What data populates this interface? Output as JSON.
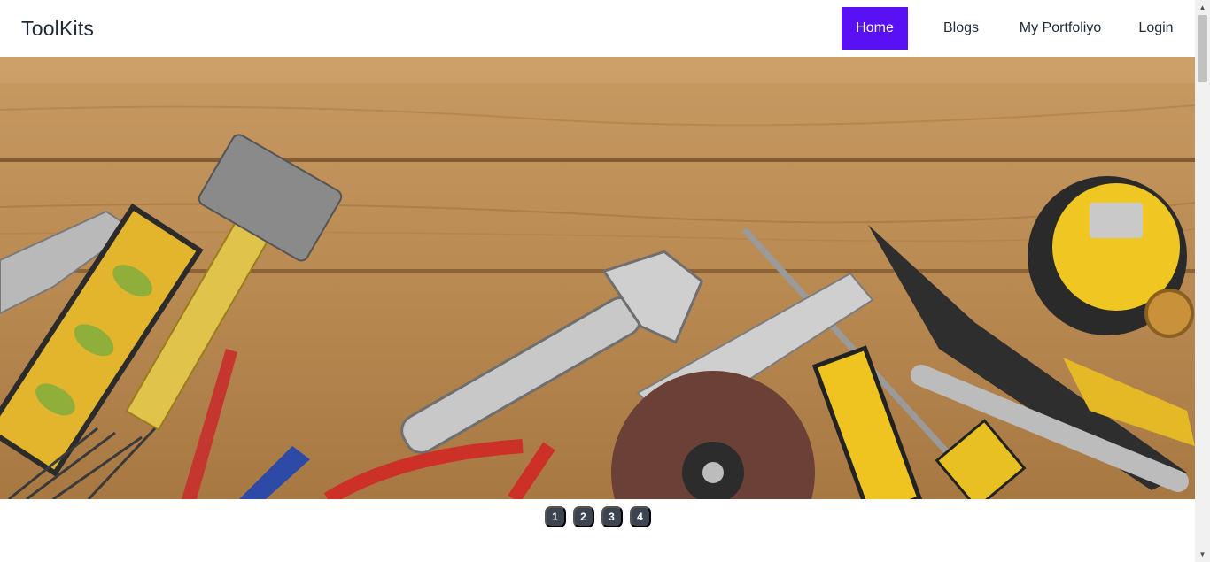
{
  "navbar": {
    "brand": "ToolKits",
    "links": [
      {
        "label": "Home",
        "active": true
      },
      {
        "label": "Blogs",
        "active": false
      },
      {
        "label": "My Portfoliyo",
        "active": false
      },
      {
        "label": "Login",
        "active": false
      }
    ],
    "active_color": "#5a10f5"
  },
  "hero": {
    "image_subject": "hand tools on wooden planks"
  },
  "carousel": {
    "pages": [
      "1",
      "2",
      "3",
      "4"
    ]
  },
  "icons": {
    "scroll_up": "triangle-up-icon",
    "scroll_down": "triangle-down-icon"
  }
}
